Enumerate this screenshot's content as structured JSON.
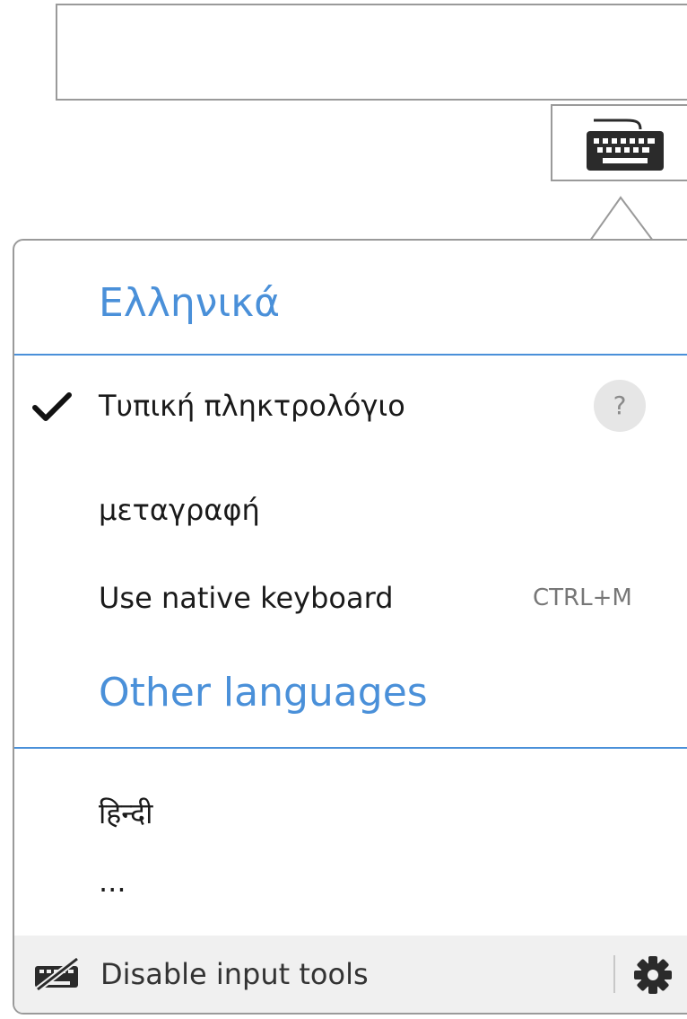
{
  "input": {
    "value": ""
  },
  "keyboard_toggle": {
    "icon": "keyboard-icon"
  },
  "menu": {
    "sections": [
      {
        "title": "Ελληνικά",
        "items": [
          {
            "label": "Τυπική πληκτρολόγιο",
            "checked": true,
            "help": "?"
          },
          {
            "label": "μεταγραφή",
            "checked": false
          },
          {
            "label": "Use native keyboard",
            "shortcut": "CTRL+M"
          }
        ]
      },
      {
        "title": "Other languages",
        "items": [
          {
            "label": "हिन्दी"
          },
          {
            "label": "..."
          }
        ]
      }
    ],
    "footer": {
      "disable_label": "Disable input tools",
      "disable_icon": "keyboard-off-icon",
      "settings_icon": "gear-icon"
    }
  },
  "colors": {
    "accent": "#4a90d9",
    "border": "#9a9a9a",
    "footer_bg": "#f0f0f0",
    "help_bg": "#e6e6e6"
  }
}
